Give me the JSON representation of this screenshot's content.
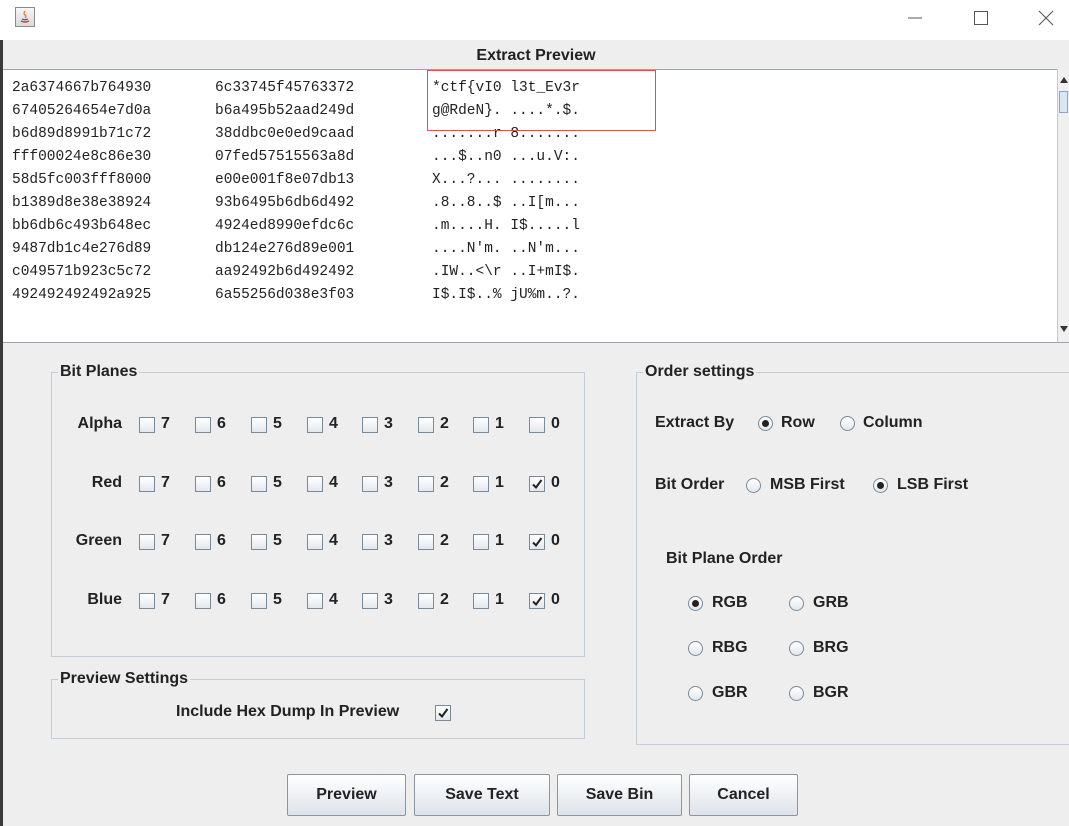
{
  "window": {
    "title": "",
    "controls": [
      "minimize-icon",
      "maximize-icon",
      "close-icon"
    ]
  },
  "extract_preview": {
    "title": "Extract Preview",
    "rows": [
      [
        "2a6374667b764930",
        "6c33745f45763372",
        "*ctf{vI0 l3t_Ev3r"
      ],
      [
        "67405264654e7d0a",
        "b6a495b52aad249d",
        "g@RdeN}. ....*.$."
      ],
      [
        "b6d89d8991b71c72",
        "38ddbc0e0ed9caad",
        ".......r 8......."
      ],
      [
        "fff00024e8c86e30",
        "07fed57515563a8d",
        "...$..n0 ...u.V:."
      ],
      [
        "58d5fc003fff8000",
        "e00e001f8e07db13",
        "X...?... ........"
      ],
      [
        "b1389d8e38e38924",
        "93b6495b6db6d492",
        ".8..8..$ ..I[m..."
      ],
      [
        "bb6db6c493b648ec",
        "4924ed8990efdc6c",
        ".m....H. I$.....l"
      ],
      [
        "9487db1c4e276d89",
        "db124e276d89e001",
        "....N'm. ..N'm..."
      ],
      [
        "c049571b923c5c72",
        "aa92492b6d492492",
        ".IW..<\\r ..I+mI$."
      ],
      [
        "492492492492a925",
        "6a55256d038e3f03",
        "I$.I$..% jU%m..?."
      ]
    ]
  },
  "bit_planes": {
    "legend": "Bit Planes",
    "bits": [
      "7",
      "6",
      "5",
      "4",
      "3",
      "2",
      "1",
      "0"
    ],
    "channels": [
      {
        "name": "Alpha",
        "checked": [
          false,
          false,
          false,
          false,
          false,
          false,
          false,
          false
        ]
      },
      {
        "name": "Red",
        "checked": [
          false,
          false,
          false,
          false,
          false,
          false,
          false,
          true
        ]
      },
      {
        "name": "Green",
        "checked": [
          false,
          false,
          false,
          false,
          false,
          false,
          false,
          true
        ]
      },
      {
        "name": "Blue",
        "checked": [
          false,
          false,
          false,
          false,
          false,
          false,
          false,
          true
        ]
      }
    ]
  },
  "order_settings": {
    "legend": "Order settings",
    "extract_by": {
      "label": "Extract By",
      "options": [
        "Row",
        "Column"
      ],
      "selected": "Row"
    },
    "bit_order": {
      "label": "Bit Order",
      "options": [
        "MSB First",
        "LSB First"
      ],
      "selected": "LSB First"
    },
    "bit_plane_order": {
      "label": "Bit Plane Order",
      "options": [
        "RGB",
        "GRB",
        "RBG",
        "BRG",
        "GBR",
        "BGR"
      ],
      "selected": "RGB"
    }
  },
  "preview_settings": {
    "legend": "Preview Settings",
    "include_hex_label": "Include Hex Dump In Preview",
    "include_hex_checked": true
  },
  "buttons": {
    "preview": "Preview",
    "save_text": "Save Text",
    "save_bin": "Save Bin",
    "cancel": "Cancel"
  }
}
